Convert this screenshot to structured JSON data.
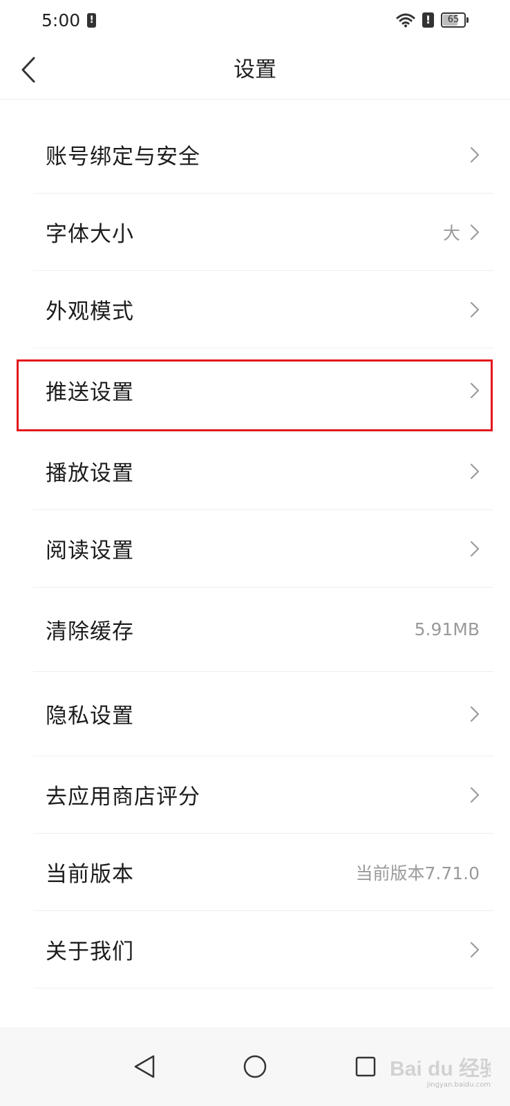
{
  "status_bar": {
    "time": "5:00",
    "battery_level": "65",
    "icons": [
      "notification-alert-icon",
      "wifi-icon",
      "alert-icon",
      "battery-icon"
    ]
  },
  "header": {
    "title": "设置",
    "back_icon": "chevron-left-icon"
  },
  "settings": [
    {
      "label": "账号绑定与安全",
      "value": "",
      "chevron": true
    },
    {
      "label": "字体大小",
      "value": "大",
      "chevron": true
    },
    {
      "label": "外观模式",
      "value": "",
      "chevron": true
    },
    {
      "label": "推送设置",
      "value": "",
      "chevron": true,
      "highlighted": true
    },
    {
      "label": "播放设置",
      "value": "",
      "chevron": true
    },
    {
      "label": "阅读设置",
      "value": "",
      "chevron": true
    },
    {
      "label": "清除缓存",
      "value": "5.91MB",
      "chevron": false
    },
    {
      "label": "隐私设置",
      "value": "",
      "chevron": true
    },
    {
      "label": "去应用商店评分",
      "value": "",
      "chevron": true
    },
    {
      "label": "当前版本",
      "value": "当前版本7.71.0",
      "chevron": false
    },
    {
      "label": "关于我们",
      "value": "",
      "chevron": true
    }
  ],
  "nav_bar": {
    "icons": [
      "nav-back-icon",
      "nav-home-icon",
      "nav-recents-icon"
    ]
  },
  "watermark": {
    "text": "Bai du 经验",
    "sub": "jingyan.baidu.com"
  },
  "colors": {
    "highlight": "#e3161c",
    "text_primary": "#1c1c1c",
    "text_secondary": "#9a9a9a",
    "divider": "#eeeeee",
    "nav_background": "#f7f7f7"
  }
}
